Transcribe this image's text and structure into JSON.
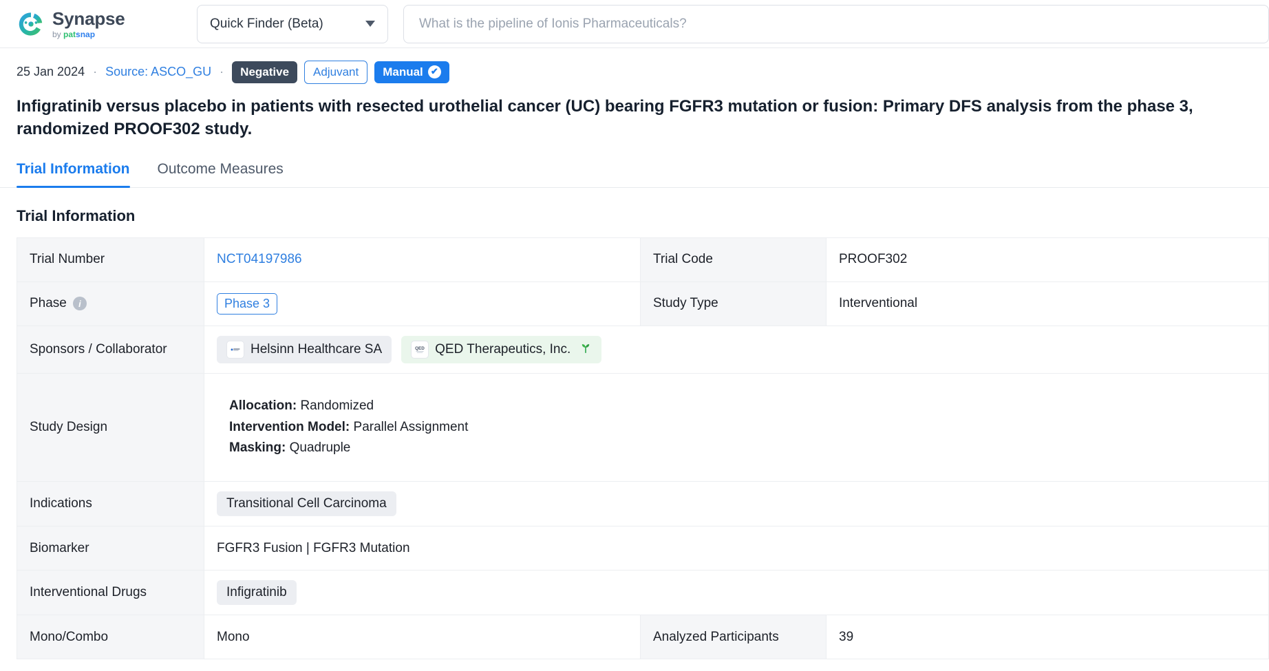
{
  "header": {
    "logo": {
      "title": "Synapse",
      "by": "by",
      "pat": "pat",
      "snap": "snap"
    },
    "finder": {
      "label": "Quick Finder (Beta)"
    },
    "search": {
      "value": "",
      "placeholder": "What is the pipeline of Ionis Pharmaceuticals?"
    }
  },
  "meta": {
    "date": "25 Jan 2024",
    "separator": "·",
    "source": "Source: ASCO_GU",
    "badges": [
      {
        "label": "Negative",
        "style": "negative"
      },
      {
        "label": "Adjuvant",
        "style": "adjuvant"
      },
      {
        "label": "Manual",
        "style": "manual",
        "icon": "check-circle-icon"
      }
    ]
  },
  "title": "Infigratinib versus placebo in patients with resected urothelial cancer (UC) bearing FGFR3 mutation or fusion: Primary DFS analysis from the phase 3, randomized PROOF302 study.",
  "tabs": [
    {
      "label": "Trial Information",
      "active": true
    },
    {
      "label": "Outcome Measures",
      "active": false
    }
  ],
  "section": {
    "heading": "Trial Information"
  },
  "table": {
    "trial_number": {
      "label": "Trial Number",
      "value": "NCT04197986"
    },
    "trial_code": {
      "label": "Trial Code",
      "value": "PROOF302"
    },
    "phase": {
      "label": "Phase",
      "value": "Phase 3",
      "info_icon": "info-icon"
    },
    "study_type": {
      "label": "Study Type",
      "value": "Interventional"
    },
    "sponsors": {
      "label": "Sponsors / Collaborator",
      "items": [
        {
          "name": "Helsinn Healthcare SA",
          "style": "gray",
          "logo": "helsinn-logo-icon"
        },
        {
          "name": "QED Therapeutics, Inc.",
          "style": "green",
          "logo": "qed-logo-icon",
          "trailing_icon": "sprout-icon"
        }
      ]
    },
    "study_design": {
      "label": "Study Design",
      "lines": [
        {
          "key": "Allocation:",
          "value": "Randomized"
        },
        {
          "key": "Intervention Model:",
          "value": "Parallel Assignment"
        },
        {
          "key": "Masking:",
          "value": "Quadruple"
        }
      ]
    },
    "indications": {
      "label": "Indications",
      "values": [
        "Transitional Cell Carcinoma"
      ]
    },
    "biomarker": {
      "label": "Biomarker",
      "value": "FGFR3 Fusion | FGFR3 Mutation"
    },
    "interventional_drugs": {
      "label": "Interventional Drugs",
      "values": [
        "Infigratinib"
      ]
    },
    "mono_combo": {
      "label": "Mono/Combo",
      "value": "Mono"
    },
    "analyzed_participants": {
      "label": "Analyzed Participants",
      "value": "39"
    }
  },
  "colors": {
    "accent_blue": "#1b7ced",
    "link_blue": "#2f7fe0",
    "badge_dark": "#3d4a5c",
    "tag_gray": "#eceef2",
    "tag_green": "#eaf6ec",
    "label_bg": "#f5f6f8",
    "border": "#eceef1"
  }
}
